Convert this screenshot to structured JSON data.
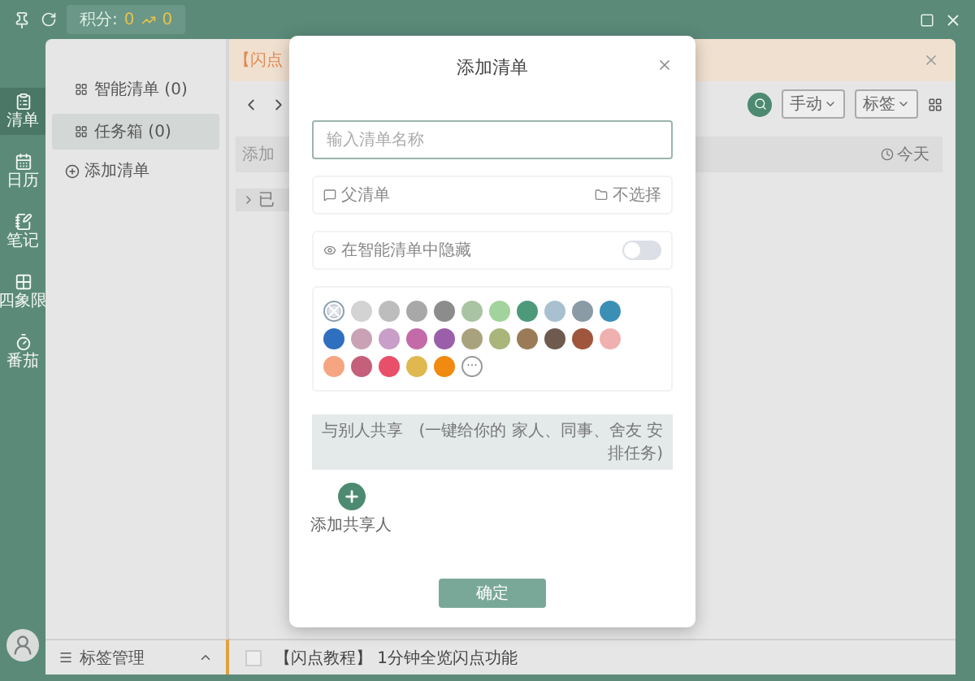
{
  "titlebar": {
    "points_label": "积分:",
    "points": "0",
    "trend": "0"
  },
  "rail": {
    "items": [
      {
        "label": "清单",
        "selected": true
      },
      {
        "label": "日历",
        "selected": false
      },
      {
        "label": "笔记",
        "selected": false
      },
      {
        "label": "四象限",
        "selected": false
      },
      {
        "label": "番茄",
        "selected": false
      }
    ]
  },
  "lists": {
    "items": [
      {
        "label": "智能清单 (0)",
        "selected": false
      },
      {
        "label": "任务箱 (0)",
        "selected": true
      }
    ],
    "add": "添加清单",
    "footer": "标签管理"
  },
  "banner": {
    "text": "【闪点"
  },
  "toolbar": {
    "sort": "手动",
    "tag": "标签"
  },
  "task_input": {
    "placeholder": "添加",
    "date": "今天"
  },
  "group": {
    "label": "已"
  },
  "status_bar": {
    "checked": false,
    "text": "【闪点教程】 1分钟全览闪点功能"
  },
  "dialog": {
    "title": "添加清单",
    "name_placeholder": "输入清单名称",
    "parent_label": "父清单",
    "parent_value": "不选择",
    "hide_label": "在智能清单中隐藏",
    "hide_on": false,
    "swatches": [
      {
        "kind": "none",
        "selected": true
      },
      {
        "kind": "color",
        "color": "#d3d3d3",
        "selected": false
      },
      {
        "kind": "color",
        "color": "#bdbdbd",
        "selected": false
      },
      {
        "kind": "color",
        "color": "#a8a8a8",
        "selected": false
      },
      {
        "kind": "color",
        "color": "#8c8c8c",
        "selected": false
      },
      {
        "kind": "color",
        "color": "#a9c4a3",
        "selected": false
      },
      {
        "kind": "color",
        "color": "#a3d39c",
        "selected": false
      },
      {
        "kind": "color",
        "color": "#4d9a7a",
        "selected": false
      },
      {
        "kind": "color",
        "color": "#a9c0d1",
        "selected": false
      },
      {
        "kind": "color",
        "color": "#8a9ba5",
        "selected": false
      },
      {
        "kind": "color",
        "color": "#3b8fb5",
        "selected": false
      },
      {
        "kind": "color",
        "color": "#2e6fc0",
        "selected": false
      },
      {
        "kind": "color",
        "color": "#c9a3b5",
        "selected": false
      },
      {
        "kind": "color",
        "color": "#c99ec9",
        "selected": false
      },
      {
        "kind": "color",
        "color": "#c46aa8",
        "selected": false
      },
      {
        "kind": "color",
        "color": "#9b5ea8",
        "selected": false
      },
      {
        "kind": "color",
        "color": "#a8a27e",
        "selected": false
      },
      {
        "kind": "color",
        "color": "#a9b57a",
        "selected": false
      },
      {
        "kind": "color",
        "color": "#9b7a58",
        "selected": false
      },
      {
        "kind": "color",
        "color": "#6e5a4e",
        "selected": false
      },
      {
        "kind": "color",
        "color": "#a0563c",
        "selected": false
      },
      {
        "kind": "color",
        "color": "#f0b0b0",
        "selected": false
      },
      {
        "kind": "color",
        "color": "#f5a582",
        "selected": false
      },
      {
        "kind": "color",
        "color": "#c4607a",
        "selected": false
      },
      {
        "kind": "color",
        "color": "#e8506a",
        "selected": false
      },
      {
        "kind": "color",
        "color": "#e0b850",
        "selected": false
      },
      {
        "kind": "color",
        "color": "#f08a10",
        "selected": false
      },
      {
        "kind": "more",
        "label": "···",
        "selected": false
      }
    ],
    "share_label": "与别人共享",
    "share_hint": "(一键给你的 家人、同事、舍友 安排任务)",
    "add_person": "添加共享人",
    "confirm": "确定"
  }
}
